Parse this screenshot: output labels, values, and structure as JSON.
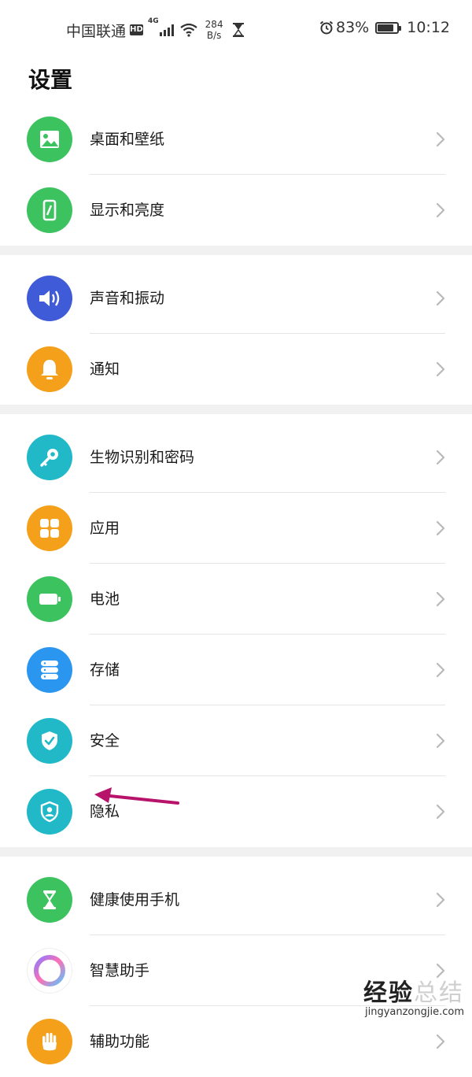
{
  "status_bar": {
    "carrier": "中国联通",
    "hd": "HD",
    "network_gen": "4G",
    "speed_value": "284",
    "speed_unit": "B/s",
    "battery_percent": "83%",
    "battery_level": 0.83,
    "time": "10:12"
  },
  "page": {
    "title": "设置"
  },
  "groups": [
    {
      "items": [
        {
          "label": "桌面和壁纸",
          "icon": "wallpaper-icon",
          "color": "#3cc35f"
        },
        {
          "label": "显示和亮度",
          "icon": "display-icon",
          "color": "#3cc35f"
        }
      ]
    },
    {
      "items": [
        {
          "label": "声音和振动",
          "icon": "sound-icon",
          "color": "#3f5bd8"
        },
        {
          "label": "通知",
          "icon": "bell-icon",
          "color": "#f5a01a"
        }
      ]
    },
    {
      "items": [
        {
          "label": "生物识别和密码",
          "icon": "key-icon",
          "color": "#21b9c8"
        },
        {
          "label": "应用",
          "icon": "apps-icon",
          "color": "#f5a01a"
        },
        {
          "label": "电池",
          "icon": "battery-icon",
          "color": "#3cc35f"
        },
        {
          "label": "存储",
          "icon": "storage-icon",
          "color": "#2b96f0"
        },
        {
          "label": "安全",
          "icon": "shield-check-icon",
          "color": "#21b9c8"
        },
        {
          "label": "隐私",
          "icon": "privacy-icon",
          "color": "#21b9c8"
        }
      ]
    },
    {
      "items": [
        {
          "label": "健康使用手机",
          "icon": "hourglass-icon",
          "color": "#3cc35f"
        },
        {
          "label": "智慧助手",
          "icon": "assistant-icon",
          "color": "#ffffff"
        },
        {
          "label": "辅助功能",
          "icon": "hand-icon",
          "color": "#f5a01a"
        }
      ]
    }
  ],
  "watermark": {
    "main_dark": "经验",
    "main_ghost": "总结",
    "sub": "jingyanzongjie.com"
  }
}
